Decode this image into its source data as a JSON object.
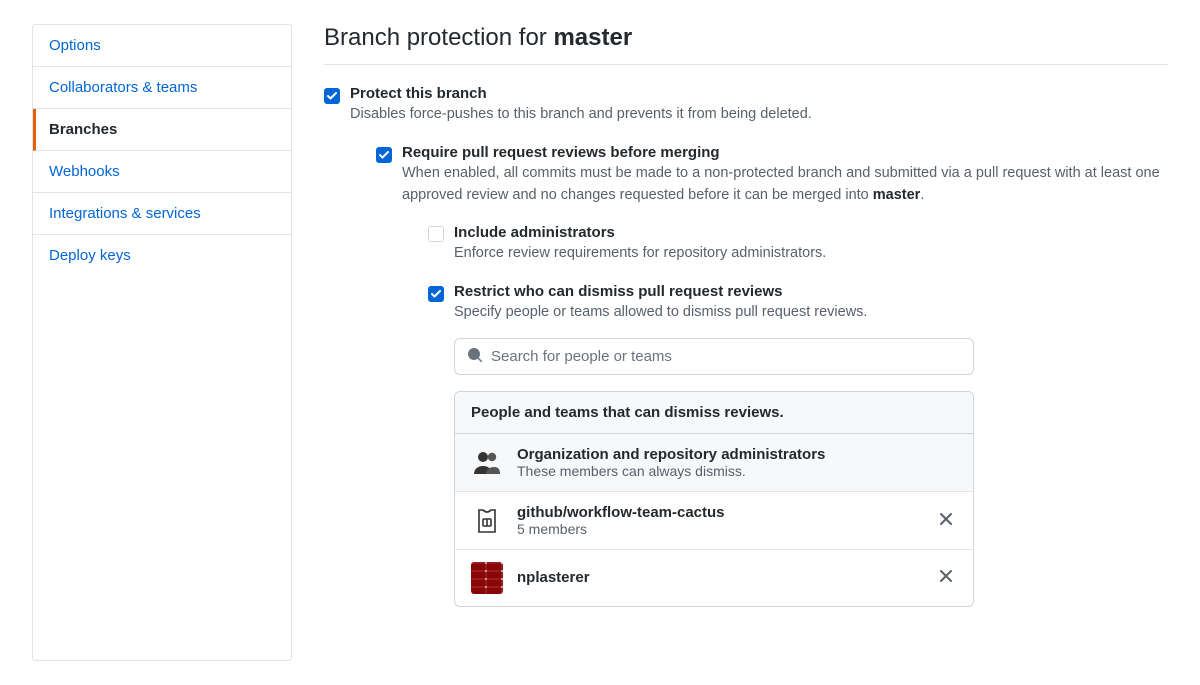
{
  "sidebar": {
    "items": [
      {
        "label": "Options",
        "active": false
      },
      {
        "label": "Collaborators & teams",
        "active": false
      },
      {
        "label": "Branches",
        "active": true
      },
      {
        "label": "Webhooks",
        "active": false
      },
      {
        "label": "Integrations & services",
        "active": false
      },
      {
        "label": "Deploy keys",
        "active": false
      }
    ]
  },
  "page": {
    "title_prefix": "Branch protection for ",
    "branch_name": "master"
  },
  "protect": {
    "checked": true,
    "title": "Protect this branch",
    "desc": "Disables force-pushes to this branch and prevents it from being deleted."
  },
  "require_reviews": {
    "checked": true,
    "title": "Require pull request reviews before merging",
    "desc_prefix": "When enabled, all commits must be made to a non-protected branch and submitted via a pull request with at least one approved review and no changes requested before it can be merged into ",
    "desc_branch": "master",
    "desc_suffix": "."
  },
  "include_admins": {
    "checked": false,
    "title": "Include administrators",
    "desc": "Enforce review requirements for repository administrators."
  },
  "restrict_dismiss": {
    "checked": true,
    "title": "Restrict who can dismiss pull request reviews",
    "desc": "Specify people or teams allowed to dismiss pull request reviews."
  },
  "search": {
    "placeholder": "Search for people or teams"
  },
  "dismiss_panel": {
    "header": "People and teams that can dismiss reviews.",
    "admins_row": {
      "title": "Organization and repository administrators",
      "sub": "These members can always dismiss."
    },
    "entries": [
      {
        "name": "github/workflow-team-cactus",
        "sub": "5 members",
        "kind": "team"
      },
      {
        "name": "nplasterer",
        "sub": "",
        "kind": "user"
      }
    ]
  }
}
